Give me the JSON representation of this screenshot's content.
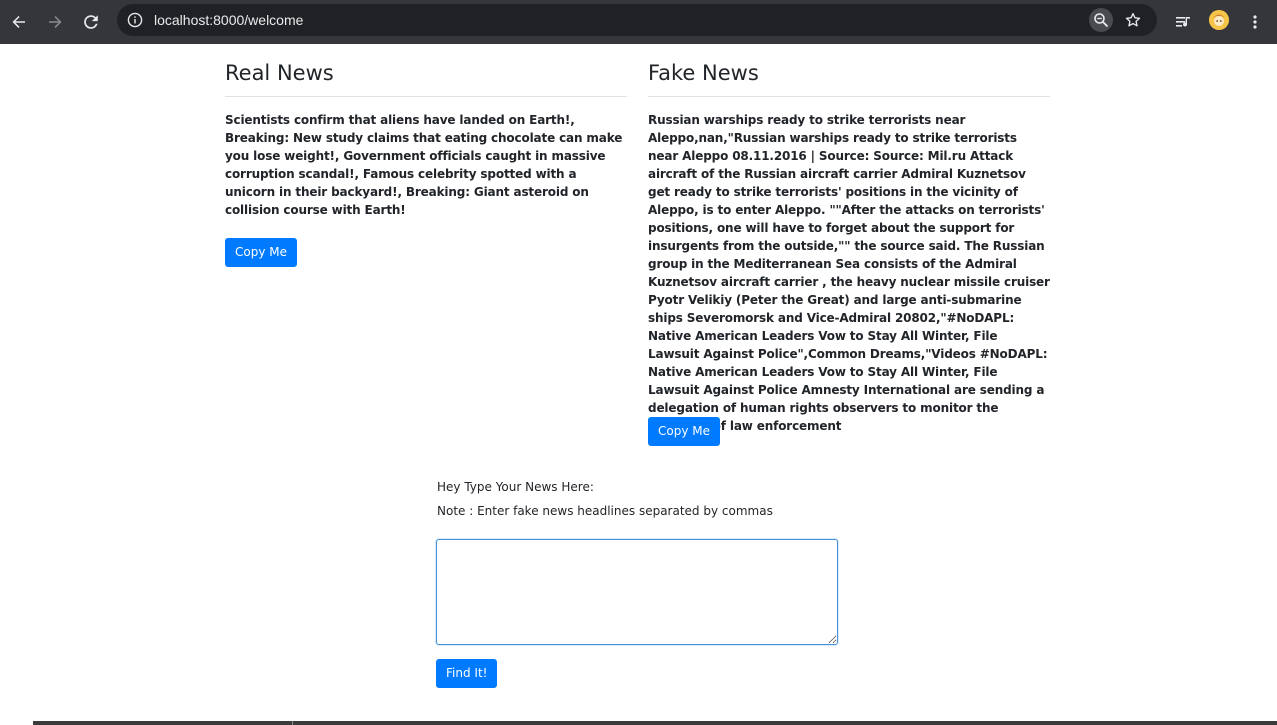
{
  "browser": {
    "url": "localhost:8000/welcome",
    "icons": {
      "back": "back-arrow-icon",
      "forward": "forward-arrow-icon",
      "reload": "reload-icon",
      "info": "site-info-icon",
      "zoom": "zoom-icon",
      "bookmark": "star-icon",
      "media": "media-controls-icon",
      "profile": "profile-avatar",
      "menu": "kebab-menu-icon"
    }
  },
  "real_news": {
    "title": "Real News",
    "text": "Scientists confirm that aliens have landed on Earth!, Breaking: New study claims that eating chocolate can make you lose weight!, Government officials caught in massive corruption scandal!, Famous celebrity spotted with a unicorn in their backyard!, Breaking: Giant asteroid on collision course with Earth!",
    "copy_label": "Copy Me"
  },
  "fake_news": {
    "title": "Fake News",
    "text": "Russian warships ready to strike terrorists near Aleppo,nan,\"Russian warships ready to strike terrorists near Aleppo 08.11.2016 | Source: Source: Mil.ru Attack aircraft of the Russian aircraft carrier Admiral Kuznetsov get ready to strike terrorists' positions in the vicinity of Aleppo, is to enter Aleppo. \"\"After the attacks on terrorists' positions, one will have to forget about the support for insurgents from the outside,\"\" the source said. The Russian group in the Mediterranean Sea consists of the Admiral Kuznetsov aircraft carrier , the heavy nuclear missile cruiser Pyotr Velikiy (Peter the Great) and large anti-submarine ships Severomorsk and Vice-Admiral 20802,\"#NoDAPL: Native American Leaders Vow to Stay All Winter, File Lawsuit Against Police\",Common Dreams,\"Videos #NoDAPL: Native American Leaders Vow to Stay All Winter, File Lawsuit Against Police Amnesty International are sending a delegation of human rights observers to monitor the response of law enforcement",
    "copy_label": "Copy Me"
  },
  "form": {
    "label": "Hey Type Your News Here:",
    "note": "Note : Enter fake news headlines separated by commas",
    "input_value": "",
    "submit_label": "Find It!"
  },
  "colors": {
    "primary": "#007bff",
    "chrome_bg": "#35363a",
    "omnibox_bg": "#202124"
  }
}
